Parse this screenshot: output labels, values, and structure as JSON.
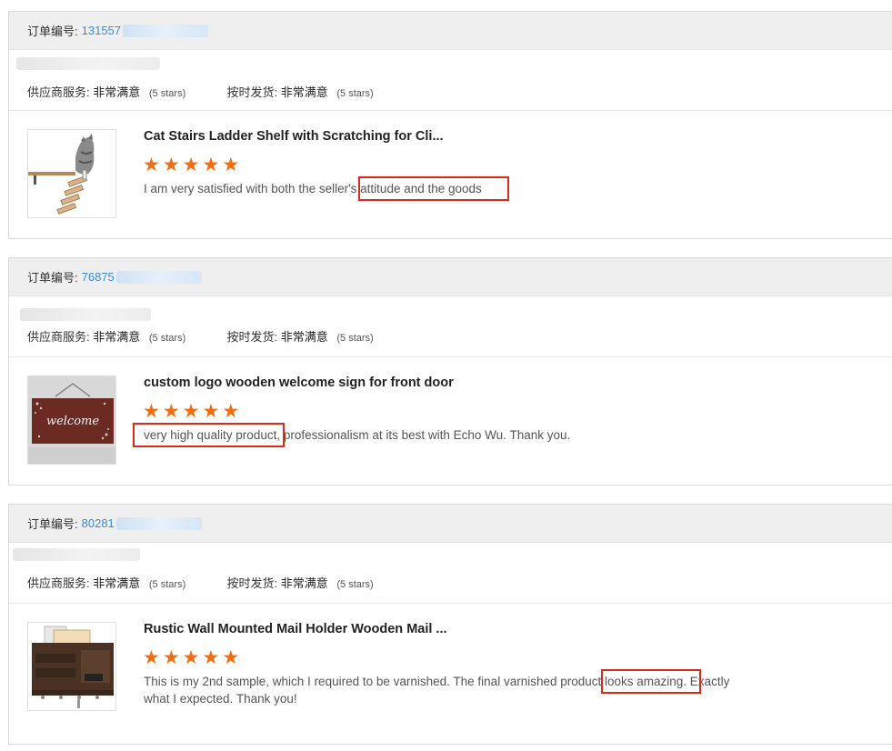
{
  "labels": {
    "order_no": "订单编号:",
    "supplier_service": "供应商服务:",
    "on_time_shipping": "按时发货:",
    "rating_value": "非常满意",
    "rating_stars": "(5 stars)"
  },
  "orders": [
    {
      "order_id": "131557",
      "product_title": "Cat Stairs Ladder Shelf with Scratching for Cli...",
      "stars": 5,
      "review": "I am very satisfied with both the seller's attitude and the goods",
      "thumb_icon": "cat-stairs-product-image"
    },
    {
      "order_id": "76875",
      "product_title": "custom logo wooden welcome sign for front door",
      "stars": 5,
      "review": "very high quality product, professionalism at its best with Echo Wu. Thank you.",
      "thumb_icon": "welcome-sign-product-image",
      "thumb_text": "welcome"
    },
    {
      "order_id": "80281",
      "product_title": "Rustic Wall Mounted Mail Holder Wooden Mail ...",
      "stars": 5,
      "review_line1": "This is my 2nd sample, which I required to be varnished. The final varnished product looks amazing. Exactly",
      "review_line2": "what I expected. Thank you!",
      "thumb_icon": "mail-holder-product-image"
    }
  ],
  "colors": {
    "accent_link": "#3b8bd9",
    "star": "#f36d0f",
    "highlight_box": "#d92a1c"
  }
}
